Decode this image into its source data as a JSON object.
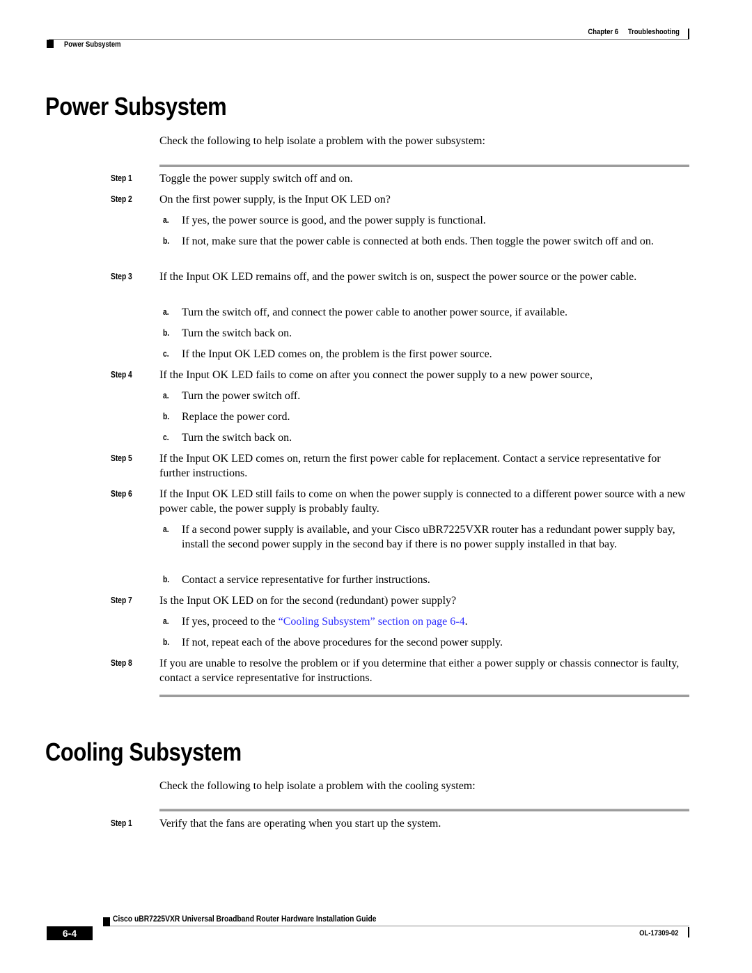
{
  "header": {
    "chapter": "Chapter 6",
    "chapter_title": "Troubleshooting",
    "section": "Power Subsystem"
  },
  "power": {
    "title": "Power Subsystem",
    "intro": "Check the following to help isolate a problem with the power subsystem:",
    "steps": [
      {
        "label": "Step 1",
        "text": "Toggle the power supply switch off and on.",
        "subs": []
      },
      {
        "label": "Step 2",
        "text": "On the first power supply, is the Input OK LED on?",
        "subs": [
          {
            "label": "a.",
            "text": "If yes, the power source is good, and the power supply is functional."
          },
          {
            "label": "b.",
            "text": "If not, make sure that the power cable is connected at both ends. Then toggle the power switch off and on."
          }
        ]
      },
      {
        "label": "Step 3",
        "text": "If the Input OK LED remains off, and the power switch is on, suspect the power source or the power cable.",
        "subs": [
          {
            "label": "a.",
            "text": "Turn the switch off, and connect the power cable to another power source, if available."
          },
          {
            "label": "b.",
            "text": "Turn the switch back on."
          },
          {
            "label": "c.",
            "text": "If the Input OK LED comes on, the problem is the first power source."
          }
        ]
      },
      {
        "label": "Step 4",
        "text": "If the Input OK LED fails to come on after you connect the power supply to a new power source,",
        "subs": [
          {
            "label": "a.",
            "text": "Turn the power switch off."
          },
          {
            "label": "b.",
            "text": "Replace the power cord."
          },
          {
            "label": "c.",
            "text": "Turn the switch back on."
          }
        ]
      },
      {
        "label": "Step 5",
        "text": "If the Input OK LED comes on, return the first power cable for replacement. Contact a service representative for further instructions.",
        "subs": []
      },
      {
        "label": "Step 6",
        "text": "If the Input OK LED still fails to come on when the power supply is connected to a different power source with a new power cable, the power supply is probably faulty.",
        "subs": [
          {
            "label": "a.",
            "text": "If a second power supply is available, and your Cisco uBR7225VXR router has a redundant power supply bay, install the second power supply in the second bay if there is no power supply installed in that bay."
          },
          {
            "label": "b.",
            "text": "Contact a service representative for further instructions."
          }
        ]
      },
      {
        "label": "Step 7",
        "text": "Is the Input OK LED on for the second (redundant) power supply?",
        "subs": [
          {
            "label": "a.",
            "text_before": "If yes, proceed to the ",
            "link": "“Cooling Subsystem” section on page 6-4",
            "text_after": "."
          },
          {
            "label": "b.",
            "text": "If not, repeat each of the above procedures for the second power supply."
          }
        ]
      },
      {
        "label": "Step 8",
        "text": "If you are unable to resolve the problem or if you determine that either a power supply or chassis connector is faulty, contact a service representative for instructions.",
        "subs": []
      }
    ]
  },
  "cooling": {
    "title": "Cooling Subsystem",
    "intro": "Check the following to help isolate a problem with the cooling system:",
    "steps": [
      {
        "label": "Step 1",
        "text": "Verify that the fans are operating when you start up the system."
      }
    ]
  },
  "footer": {
    "guide_title": "Cisco uBR7225VXR Universal Broadband Router Hardware Installation Guide",
    "page_number": "6-4",
    "doc_number": "OL-17309-02"
  },
  "colors": {
    "link": "#2a2aff",
    "rule": "#9c9c9c"
  }
}
